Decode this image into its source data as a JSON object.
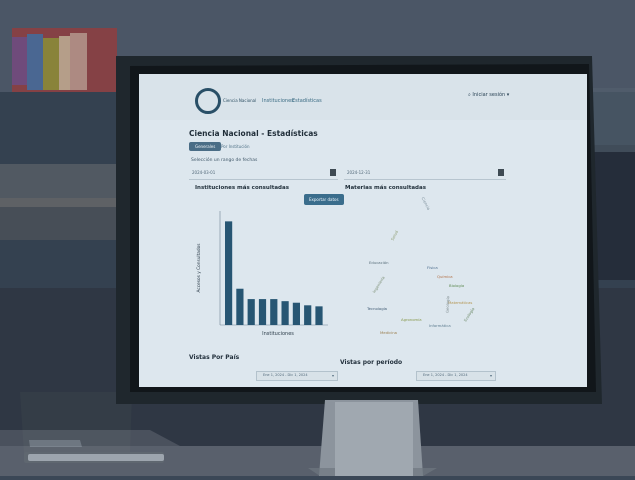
{
  "app": {
    "brand": "Ciencia Nacional",
    "nav": [
      "Instituciones",
      "Estadísticas"
    ],
    "login": "Iniciar sesión"
  },
  "page": {
    "title": "Ciencia Nacional - Estadísticas",
    "tabs": [
      "Generales",
      "Por Institución"
    ],
    "subtitle": "Selección un rango de fechas"
  },
  "dates": {
    "start": "2024-03-01",
    "end": "2024-12-31"
  },
  "sections": {
    "left": "Instituciones más consultadas",
    "right": "Materias más consultadas",
    "export": "Exportar datos",
    "bottom_left": "Vistas Por País",
    "bottom_right": "Vistas por período"
  },
  "chart_data": {
    "type": "bar",
    "categories": [
      "",
      "",
      "",
      "",
      "",
      "",
      "",
      "",
      ""
    ],
    "values": [
      20,
      7,
      5,
      5,
      5,
      4.6,
      4.3,
      3.8,
      3.6
    ],
    "xlabel": "Instituciones",
    "ylabel": "Accesos y Consultados",
    "ylim": [
      0,
      22
    ],
    "colors": [
      "#275673"
    ]
  },
  "wordcloud": [
    "Ciencia",
    "Salud",
    "Educación",
    "Física",
    "Química",
    "Biología",
    "Ingeniería",
    "Matemáticas",
    "Tecnología",
    "Agronomía",
    "Informática",
    "Medicina",
    "Geología",
    "Ecología"
  ],
  "bottom": {
    "left_select": "Ene 1, 2024 - Dic 1, 2024",
    "right_select": "Ene 1, 2024 - Dic 1, 2024"
  }
}
